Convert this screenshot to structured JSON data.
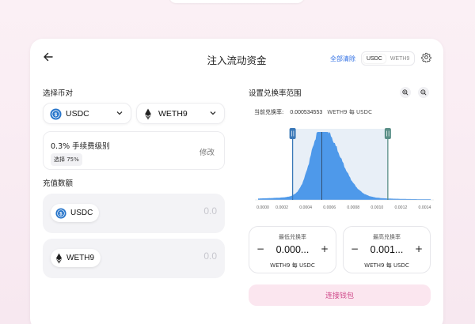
{
  "header": {
    "title": "注入流动资金",
    "clear_all": "全部清除",
    "toggle": {
      "options": [
        "USDC",
        "WETH9"
      ],
      "active": "USDC"
    }
  },
  "pair": {
    "label": "选择币对",
    "token_a": {
      "symbol": "USDC",
      "icon": "usdc-icon"
    },
    "token_b": {
      "symbol": "WETH9",
      "icon": "eth-icon"
    }
  },
  "fee": {
    "title": "0.3% 手续费级别",
    "badge": "选择 75%",
    "edit": "修改"
  },
  "deposit": {
    "label": "充值数额",
    "items": [
      {
        "symbol": "USDC",
        "amount": "0.0"
      },
      {
        "symbol": "WETH9",
        "amount": "0.0"
      }
    ]
  },
  "range": {
    "label": "设置兑换率范围",
    "current_rate_label": "当前兑换率:",
    "current_rate_value": "0.000534553",
    "current_rate_unit": "WETH9 每 USDC"
  },
  "chart_data": {
    "type": "area",
    "x_ticks": [
      "0.0000",
      "0.0002",
      "0.0004",
      "0.0006",
      "0.0008",
      "0.0010",
      "0.0012",
      "0.0014"
    ],
    "xlim": [
      0,
      0.00145
    ],
    "current_price": 0.000534553,
    "range": [
      0.00029,
      0.00109
    ],
    "color_fill": "#3d8fe8",
    "color_range": "#4a86c0"
  },
  "price_boxes": {
    "min": {
      "label": "最低兑换率",
      "value": "0.000...",
      "unit": "WETH9 每 USDC"
    },
    "max": {
      "label": "最高兑换率",
      "value": "0.001...",
      "unit": "WETH9 每 USDC"
    }
  },
  "connect": {
    "label": "连接钱包"
  }
}
